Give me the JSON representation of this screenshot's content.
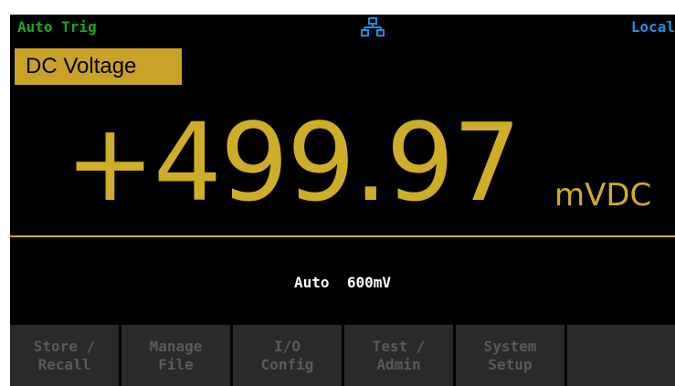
{
  "status_bar": {
    "trigger_mode": "Auto Trig",
    "network_icon": "network-icon",
    "remote_state": "Local"
  },
  "display": {
    "function": "DC Voltage",
    "reading": "+499.97",
    "unit": "mVDC",
    "range": "Auto  600mV"
  },
  "softkeys": [
    {
      "line1": "Store /",
      "line2": "Recall"
    },
    {
      "line1": "Manage",
      "line2": "File"
    },
    {
      "line1": "I/O",
      "line2": "Config"
    },
    {
      "line1": "Test /",
      "line2": "Admin"
    },
    {
      "line1": "System",
      "line2": "Setup"
    },
    {
      "line1": "",
      "line2": ""
    }
  ],
  "colors": {
    "accent": "#cfad28",
    "trigger_text": "#1fa51f",
    "remote_text": "#1e8fe0",
    "softkey_bg": "#2a2a2a",
    "softkey_text": "#5a5a5a"
  }
}
